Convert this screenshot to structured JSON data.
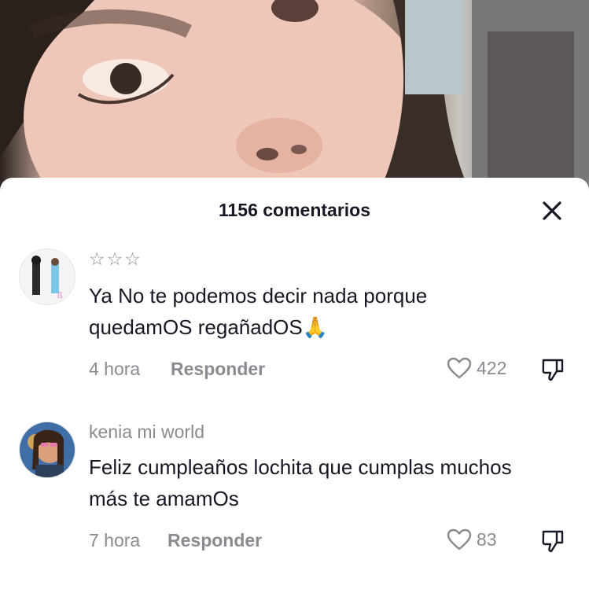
{
  "header": {
    "title": "1156 comentarios"
  },
  "icons": {
    "close": "close-icon",
    "like": "heart-outline-icon",
    "dislike": "thumbs-down-icon",
    "emoji": "🙏"
  },
  "comments": [
    {
      "username": "☆☆☆",
      "text": "Ya No te podemos decir nada porque quedamOS regañadOS",
      "emoji": "🙏",
      "time": "4 hora",
      "reply_label": "Responder",
      "likes": "422"
    },
    {
      "username": "kenia mi world",
      "text": "Feliz cumpleaños lochita que cumplas muchos más te amamOs",
      "time": "7 hora",
      "reply_label": "Responder",
      "likes": "83"
    }
  ],
  "colors": {
    "text_primary": "#161823",
    "text_secondary": "#8a8b91",
    "background": "#ffffff"
  }
}
